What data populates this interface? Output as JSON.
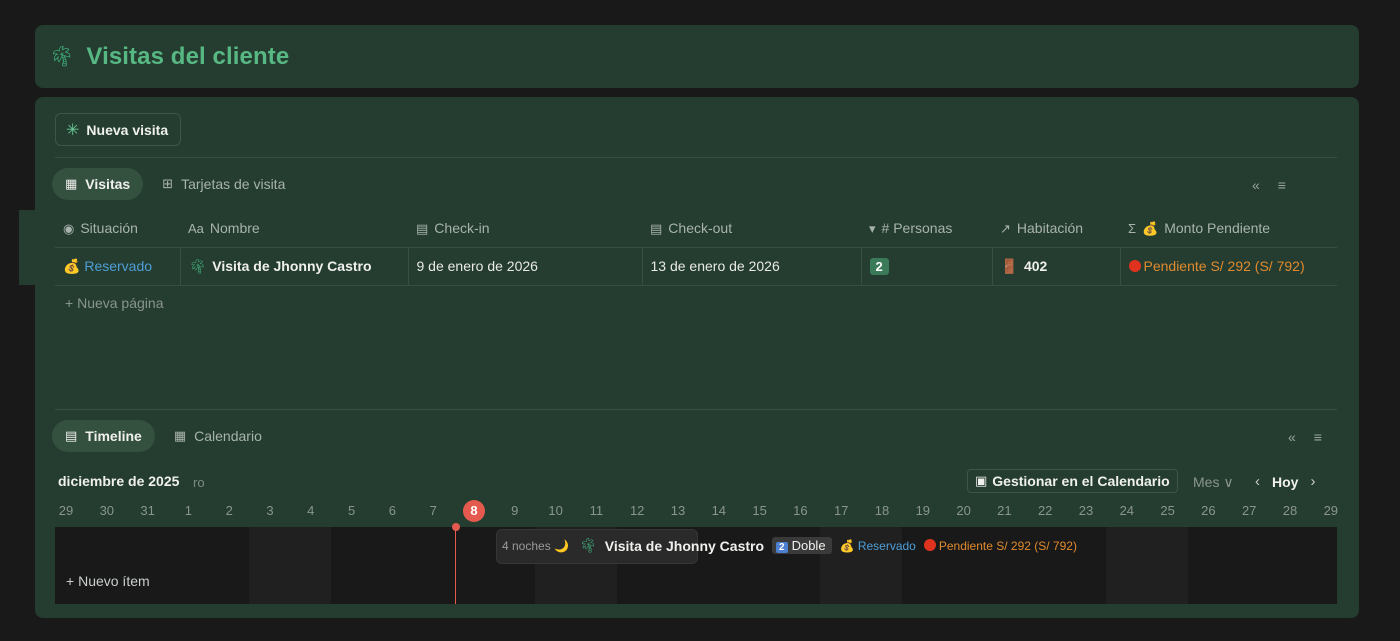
{
  "page": {
    "title": "Visitas del cliente",
    "title_icon": "palm-tree-icon"
  },
  "toolbar": {
    "new_visit_label": "Nueva visita"
  },
  "views_top": {
    "tabs": [
      {
        "label": "Visitas",
        "icon": "table-icon",
        "active": true
      },
      {
        "label": "Tarjetas de visita",
        "icon": "gallery-icon",
        "active": false
      }
    ]
  },
  "table": {
    "columns": [
      {
        "label": "Situación",
        "icon": "eye-icon"
      },
      {
        "label": "Nombre",
        "icon": "text-icon",
        "icon_text": "Aa"
      },
      {
        "label": "Check-in",
        "icon": "calendar-icon"
      },
      {
        "label": "Check-out",
        "icon": "calendar-icon"
      },
      {
        "label": "# Personas",
        "icon": "select-icon"
      },
      {
        "label": "Habitación",
        "icon": "relation-arrow-icon"
      },
      {
        "label": "Monto Pendiente",
        "icon": "sigma-icon",
        "icon_text": "Σ"
      }
    ],
    "rows": [
      {
        "situacion": "Reservado",
        "nombre": "Visita de Jhonny Castro",
        "check_in": "9 de enero de 2026",
        "check_out": "13 de enero de 2026",
        "personas": "2",
        "habitacion": "402",
        "monto": "Pendiente S/ 292 (S/ 792)"
      }
    ],
    "new_page_label": "Nueva página"
  },
  "views_bottom": {
    "tabs": [
      {
        "label": "Timeline",
        "icon": "timeline-icon",
        "active": true
      },
      {
        "label": "Calendario",
        "icon": "calendar-icon",
        "active": false
      }
    ]
  },
  "timeline": {
    "month_label": "diciembre de 2025",
    "month_ghost": "ro",
    "manage_button": "Gestionar en el Calendario",
    "scale_label": "Mes",
    "today_button": "Hoy",
    "days": [
      "29",
      "30",
      "31",
      "1",
      "2",
      "3",
      "4",
      "5",
      "6",
      "7",
      "8",
      "9",
      "10",
      "11",
      "12",
      "13",
      "14",
      "15",
      "16",
      "17",
      "18",
      "19",
      "20",
      "21",
      "22",
      "23",
      "24",
      "25",
      "26",
      "27",
      "28",
      "29"
    ],
    "today": "8",
    "item": {
      "nights": "4 noches",
      "name": "Visita de Jhonny Castro",
      "room_num": "2",
      "room_type": "Doble",
      "status": "Reservado",
      "pending": "Pendiente S/ 292 (S/ 792)"
    },
    "new_item_label": "Nuevo ítem"
  },
  "colors": {
    "page_bg": "#191919",
    "card_bg": "#243d30",
    "title_green": "#58b883",
    "reserved_blue": "#4e9ed8",
    "pending_orange": "#e08a2e",
    "today_red": "#e55a4e"
  }
}
